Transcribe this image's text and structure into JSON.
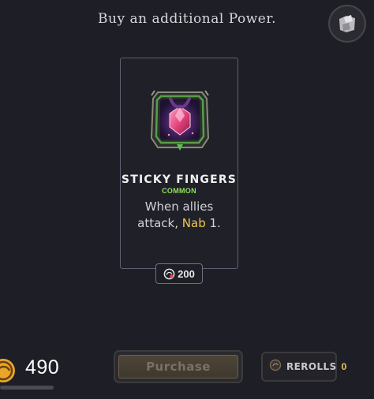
{
  "header": {
    "prompt": "Buy an additional Power."
  },
  "power": {
    "name": "STICKY FINGERS",
    "rarity": "COMMON",
    "description_prefix": "When allies",
    "description_mid": "attack,",
    "keyword": "Nab",
    "description_suffix": "1.",
    "icon": "sticky-fingers-gem-icon",
    "price": "200"
  },
  "player": {
    "gold": "490",
    "gold_icon": "coin-icon"
  },
  "actions": {
    "purchase_label": "Purchase",
    "rerolls_label": "REROLLS",
    "rerolls_count": "0"
  },
  "colors": {
    "background": "#1e1e26",
    "rarity_common": "#8fe65a",
    "keyword": "#f0c850",
    "card_border": "#5d6070"
  }
}
